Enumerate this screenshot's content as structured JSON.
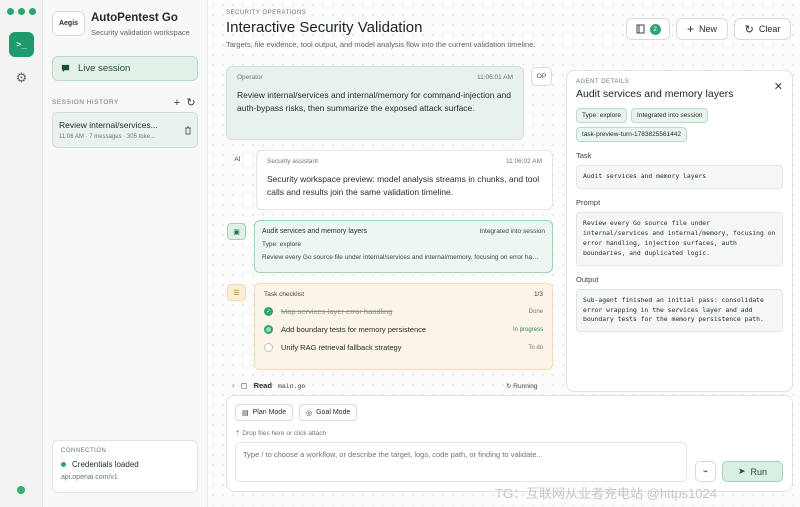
{
  "rail": {
    "terminal_glyph": ">_",
    "settings_glyph": "⚙"
  },
  "sidebar": {
    "brand": "Aegis",
    "app_name": "AutoPentest Go",
    "app_subtitle": "Security validation workspace",
    "live_session": "Live session",
    "history_label": "SESSION HISTORY",
    "sessions": [
      {
        "title": "Review internal/services...",
        "meta": "11:06 AM · 7 messages · 305 toke..."
      }
    ],
    "connection": {
      "label": "CONNECTION",
      "status": "Credentials loaded",
      "host": "api.openai.com/v1"
    }
  },
  "header": {
    "eyebrow": "SECURITY OPERATIONS",
    "title": "Interactive Security Validation",
    "subtitle": "Targets, file evidence, tool output, and model analysis flow into the current validation timeline.",
    "badge_count": "2",
    "new_label": "New",
    "clear_label": "Clear"
  },
  "timeline": {
    "operator": {
      "author": "Operator",
      "time": "11:06:01 AM",
      "avatar": "OP",
      "text": "Review internal/services and internal/memory for command-injection and auth-bypass risks, then summarize the exposed attack surface."
    },
    "assistant": {
      "author": "Security assistant",
      "time": "11:06:02 AM",
      "avatar": "AI",
      "text": "Security workspace preview: model analysis streams in chunks, and tool calls and results join the same validation timeline."
    },
    "agent": {
      "title": "Audit services and memory layers",
      "state": "Integrated into session",
      "type": "Type: explore",
      "prompt": "Review every Go source file under internal/services and internal/memory, focusing on error handling..."
    },
    "checklist": {
      "title": "Task checklist",
      "progress": "1/3",
      "items": [
        {
          "label": "Map services-layer error handling",
          "state": "Done"
        },
        {
          "label": "Add boundary tests for memory persistence",
          "state": "In progress"
        },
        {
          "label": "Unify RAG retrieval fallback strategy",
          "state": "To do"
        }
      ]
    },
    "read": {
      "label": "Read",
      "file": "main.go",
      "status": "Running"
    }
  },
  "details": {
    "eyebrow": "AGENT DETAILS",
    "title": "Audit services and memory layers",
    "chips": [
      "Type: explore",
      "Integrated into session",
      "task-preview-turn-1783825561442"
    ],
    "task_label": "Task",
    "task": "Audit services and memory layers",
    "prompt_label": "Prompt",
    "prompt": "Review every Go source file under internal/services and internal/memory, focusing on error handling, injection surfaces, auth boundaries, and duplicated logic.",
    "output_label": "Output",
    "output": "Sub-agent finished an initial pass: consolidate error wrapping in the services layer and add boundary tests for the memory persistence path."
  },
  "composer": {
    "plan_mode": "Plan Mode",
    "goal_mode": "Goal Mode",
    "drop_hint": "Drop files here or click attach",
    "placeholder": "Type / to choose a workflow, or describe the target, logs, code path, or finding to validate...",
    "run_label": "Run"
  },
  "watermark": "TG：互联网从业者充电站 @https1024",
  "colors": {
    "accent": "#1e9b6b",
    "accent_soft": "#e3f1e9",
    "checklist_bg": "#fcf5e7"
  }
}
